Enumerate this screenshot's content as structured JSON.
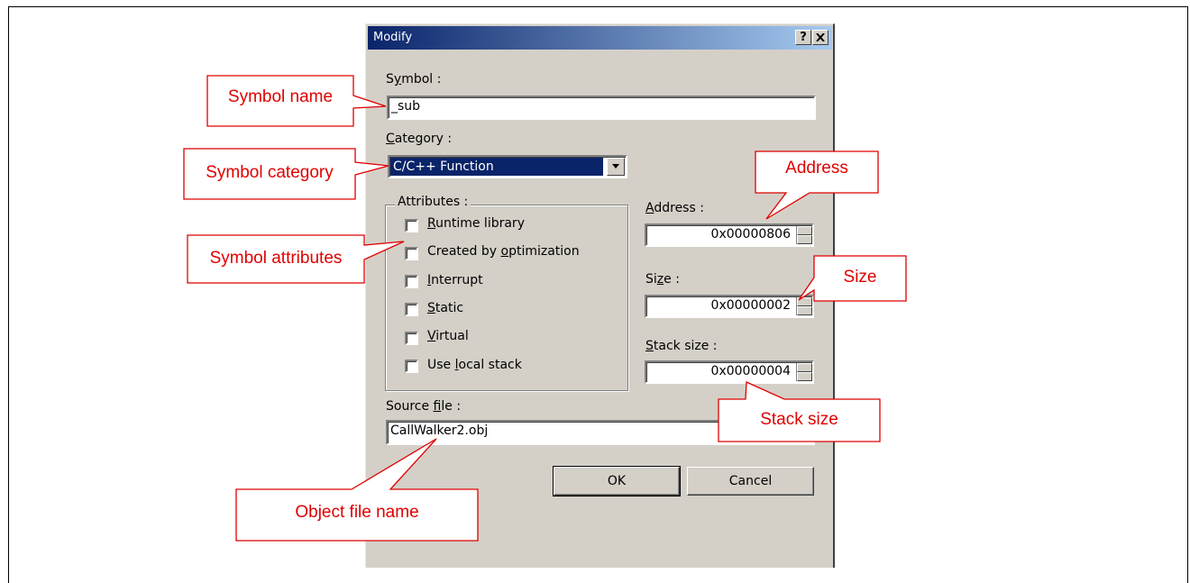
{
  "dialog": {
    "title": "Modify",
    "help_icon": "?",
    "close_icon": "close-icon",
    "symbol_label_pre": "S",
    "symbol_label_u": "y",
    "symbol_label_post": "mbol :",
    "symbol_value": "_sub",
    "category_label_u": "C",
    "category_label_post": "ategory :",
    "category_value": "C/C++ Function",
    "attributes_title": "Attributes :",
    "attributes": [
      {
        "pre": "",
        "u": "R",
        "post": "untime library",
        "checked": false
      },
      {
        "pre": "Created by ",
        "u": "o",
        "post": "ptimization",
        "checked": false
      },
      {
        "pre": "",
        "u": "I",
        "post": "nterrupt",
        "checked": false
      },
      {
        "pre": "",
        "u": "S",
        "post": "tatic",
        "checked": false
      },
      {
        "pre": "",
        "u": "V",
        "post": "irtual",
        "checked": false
      },
      {
        "pre": "Use ",
        "u": "l",
        "post": "ocal stack",
        "checked": false
      }
    ],
    "address_label_u": "A",
    "address_label_post": "ddress :",
    "address_value": "0x00000806",
    "size_label_pre": "Si",
    "size_label_u": "z",
    "size_label_post": "e :",
    "size_value": "0x00000002",
    "stack_label_pre": "",
    "stack_label_u": "S",
    "stack_label_post": "tack size :",
    "stack_value": "0x00000004",
    "source_label_pre": "Source ",
    "source_label_u": "f",
    "source_label_post": "ile :",
    "source_value": "CallWalker2.obj",
    "ok_label": "OK",
    "cancel_label": "Cancel"
  },
  "callouts": {
    "symbol_name": "Symbol name",
    "symbol_category": "Symbol category",
    "symbol_attributes": "Symbol attributes",
    "address": "Address",
    "size": "Size",
    "stack_size": "Stack size",
    "object_file_name": "Object file name"
  },
  "colors": {
    "callout_text": "#e00000",
    "callout_border": "#e00000",
    "titlebar_start": "#0a246a",
    "titlebar_end": "#a6caf0",
    "dialog_face": "#d4d0c8"
  }
}
